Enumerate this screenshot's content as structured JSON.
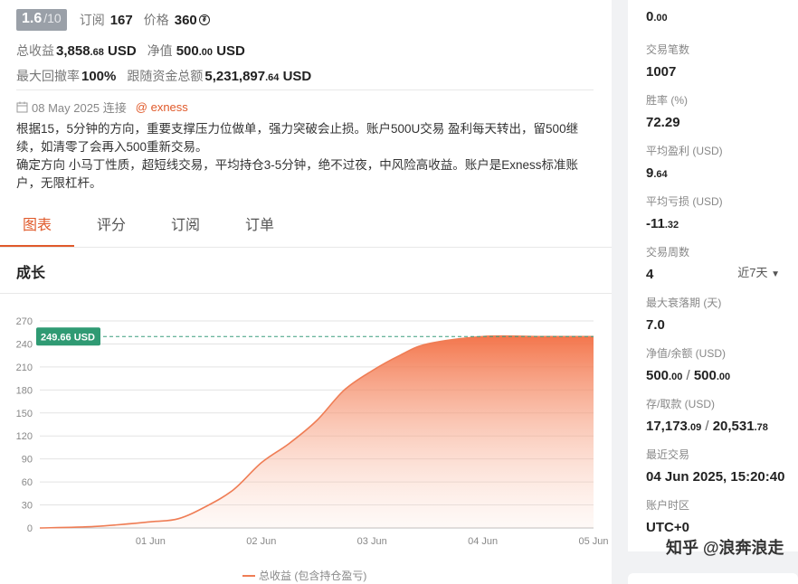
{
  "header": {
    "rating": "1.6",
    "rating_den": "/10",
    "subs_label": "订阅",
    "subs_value": "167",
    "price_label": "价格",
    "price_value": "360",
    "total_label": "总收益",
    "total_main": "3,858",
    "total_small": ".68",
    "total_unit": "USD",
    "equity_label": "净值",
    "equity_main": "500",
    "equity_small": ".00",
    "equity_unit": "USD",
    "dd_label": "最大回撤率",
    "dd_value": "100%",
    "follow_label": "跟随资金总额",
    "follow_main": "5,231,897",
    "follow_small": ".64",
    "follow_unit": "USD"
  },
  "meta": {
    "date": "08 May 2025 连接",
    "broker": "@ exness"
  },
  "description": [
    "根据15，5分钟的方向，重要支撑压力位做单，强力突破会止损。账户500U交易 盈利每天转出，留500继续，如清零了会再入500重新交易。",
    "确定方向 小马丁性质，超短线交易，平均持仓3-5分钟，绝不过夜，中风险高收益。账户是Exness标准账户，无限杠杆。"
  ],
  "tabs": [
    "图表",
    "评分",
    "订阅",
    "订单"
  ],
  "chart_section": {
    "title": "成长",
    "range": "近7天"
  },
  "chart_data": {
    "type": "area",
    "series": [
      {
        "name": "总收益 (包含持仓盈亏)",
        "color": "#ef7d55"
      }
    ],
    "x": [
      "31 May 00:00",
      "31 May 12:00",
      "01 Jun 00:00",
      "01 Jun 06:00",
      "01 Jun 12:00",
      "01 Jun 18:00",
      "02 Jun 00:00",
      "02 Jun 06:00",
      "02 Jun 12:00",
      "02 Jun 18:00",
      "03 Jun 00:00",
      "03 Jun 06:00",
      "03 Jun 12:00",
      "04 Jun 00:00",
      "04 Jun 12:00",
      "05 Jun 00:00"
    ],
    "y": [
      0,
      2,
      8,
      12,
      28,
      50,
      85,
      110,
      140,
      180,
      205,
      225,
      240,
      249.66,
      249.66,
      249.66
    ],
    "x_ticks": [
      "01 Jun",
      "02 Jun",
      "03 Jun",
      "04 Jun",
      "05 Jun"
    ],
    "y_ticks": [
      0,
      30,
      60,
      90,
      120,
      150,
      180,
      210,
      240,
      270
    ],
    "ylim": [
      0,
      270
    ],
    "marker_label": "249.66 USD",
    "marker_value": 249.66,
    "legend": "总收益 (包含持仓盈亏)",
    "legend_position": "bottom-center",
    "grid": true
  },
  "sidebar": [
    {
      "label": "",
      "main": "0",
      "small": ".00"
    },
    {
      "label": "交易笔数",
      "main": "1007",
      "small": ""
    },
    {
      "label": "胜率 (%)",
      "main": "72.29",
      "small": ""
    },
    {
      "label": "平均盈利 (USD)",
      "main": "9",
      "small": ".64"
    },
    {
      "label": "平均亏损 (USD)",
      "main": "-11",
      "small": ".32"
    },
    {
      "label": "交易周数",
      "main": "4",
      "small": ""
    },
    {
      "label": "最大衰落期 (天)",
      "main": "7.0",
      "small": ""
    },
    {
      "label": "净值/余额 (USD)",
      "main": "500",
      "small": ".00",
      "main2": "500",
      "small2": ".00"
    },
    {
      "label": "存/取款 (USD)",
      "main": "17,173",
      "small": ".09",
      "main2": "20,531",
      "small2": ".78"
    },
    {
      "label": "最近交易",
      "main": "04 Jun 2025, 15:20:40",
      "small": ""
    },
    {
      "label": "账户时区",
      "main": "UTC+0",
      "small": ""
    }
  ],
  "watermark": "知乎 @浪奔浪走"
}
